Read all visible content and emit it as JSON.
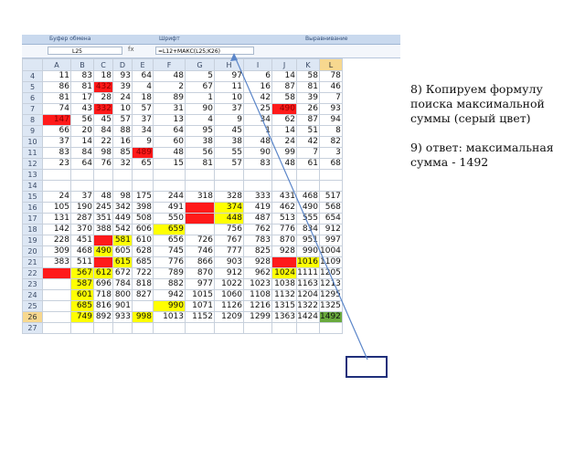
{
  "ribbon": {
    "groups": [
      "Буфер обмена",
      "Шрифт",
      "Выравнивание"
    ]
  },
  "formula_bar": {
    "name_box": "L25",
    "fx": "fx",
    "formula": "=L12+МАКС(L25;K26)"
  },
  "columns": [
    "A",
    "B",
    "C",
    "D",
    "E",
    "F",
    "G",
    "H",
    "I",
    "J",
    "K",
    "L"
  ],
  "rows": [
    {
      "n": "4",
      "c": [
        "11",
        "83",
        "18",
        "93",
        "64",
        "48",
        "5",
        "97",
        "6",
        "14",
        "58",
        "78"
      ]
    },
    {
      "n": "5",
      "c": [
        "86",
        "81",
        "432",
        "39",
        "4",
        "2",
        "67",
        "11",
        "16",
        "87",
        "81",
        "46"
      ]
    },
    {
      "n": "6",
      "c": [
        "81",
        "17",
        "28",
        "24",
        "18",
        "89",
        "1",
        "10",
        "42",
        "58",
        "39",
        "7"
      ]
    },
    {
      "n": "7",
      "c": [
        "74",
        "43",
        "332",
        "10",
        "57",
        "31",
        "90",
        "37",
        "25",
        "490",
        "26",
        "93"
      ]
    },
    {
      "n": "8",
      "c": [
        "147",
        "56",
        "45",
        "57",
        "37",
        "13",
        "4",
        "9",
        "34",
        "62",
        "87",
        "94"
      ]
    },
    {
      "n": "9",
      "c": [
        "66",
        "20",
        "84",
        "88",
        "34",
        "64",
        "95",
        "45",
        "1",
        "14",
        "51",
        "8"
      ]
    },
    {
      "n": "10",
      "c": [
        "37",
        "14",
        "22",
        "16",
        "9",
        "60",
        "38",
        "38",
        "48",
        "24",
        "42",
        "82"
      ]
    },
    {
      "n": "11",
      "c": [
        "83",
        "84",
        "98",
        "85",
        "489",
        "48",
        "56",
        "55",
        "90",
        "99",
        "7",
        "3"
      ]
    },
    {
      "n": "12",
      "c": [
        "23",
        "64",
        "76",
        "32",
        "65",
        "15",
        "81",
        "57",
        "83",
        "48",
        "61",
        "68"
      ]
    },
    {
      "n": "13",
      "c": [
        "",
        "",
        "",
        "",
        "",
        "",
        "",
        "",
        "",
        "",
        "",
        ""
      ]
    },
    {
      "n": "14",
      "c": [
        "",
        "",
        "",
        "",
        "",
        "",
        "",
        "",
        "",
        "",
        "",
        ""
      ]
    },
    {
      "n": "15",
      "c": [
        "24",
        "37",
        "48",
        "98",
        "175",
        "244",
        "318",
        "328",
        "333",
        "431",
        "468",
        "517"
      ]
    },
    {
      "n": "16",
      "c": [
        "105",
        "190",
        "245",
        "342",
        "398",
        "491",
        "",
        "374",
        "419",
        "462",
        "490",
        "568"
      ]
    },
    {
      "n": "17",
      "c": [
        "131",
        "287",
        "351",
        "449",
        "508",
        "550",
        "",
        "448",
        "487",
        "513",
        "555",
        "654"
      ]
    },
    {
      "n": "18",
      "c": [
        "142",
        "370",
        "388",
        "542",
        "606",
        "659",
        "",
        "756",
        "762",
        "776",
        "834",
        "912"
      ]
    },
    {
      "n": "19",
      "c": [
        "228",
        "451",
        "",
        "581",
        "610",
        "656",
        "726",
        "767",
        "783",
        "870",
        "951",
        "997"
      ]
    },
    {
      "n": "20",
      "c": [
        "309",
        "468",
        "490",
        "605",
        "628",
        "745",
        "746",
        "777",
        "825",
        "928",
        "990",
        "1004"
      ]
    },
    {
      "n": "21",
      "c": [
        "383",
        "511",
        "",
        "615",
        "685",
        "776",
        "866",
        "903",
        "928",
        "",
        "1016",
        "1109"
      ]
    },
    {
      "n": "22",
      "c": [
        "",
        "567",
        "612",
        "672",
        "722",
        "789",
        "870",
        "912",
        "962",
        "1024",
        "1111",
        "1205"
      ]
    },
    {
      "n": "23",
      "c": [
        "",
        "587",
        "696",
        "784",
        "818",
        "882",
        "977",
        "1022",
        "1023",
        "1038",
        "1163",
        "1213"
      ]
    },
    {
      "n": "24",
      "c": [
        "",
        "601",
        "718",
        "800",
        "827",
        "942",
        "1015",
        "1060",
        "1108",
        "1132",
        "1204",
        "1295"
      ]
    },
    {
      "n": "25",
      "c": [
        "",
        "685",
        "816",
        "901",
        "",
        "990",
        "1071",
        "1126",
        "1216",
        "1315",
        "1322",
        "1325"
      ]
    },
    {
      "n": "26",
      "c": [
        "",
        "749",
        "892",
        "933",
        "998",
        "1013",
        "1152",
        "1209",
        "1299",
        "1363",
        "1424",
        "1492"
      ]
    },
    {
      "n": "27",
      "c": [
        "",
        "",
        "",
        "",
        "",
        "",
        "",
        "",
        "",
        "",
        "",
        ""
      ]
    }
  ],
  "highlights": {
    "red": [
      "5-2",
      "7-2",
      "7-9",
      "8-0",
      "11-4",
      "16-6",
      "17-6",
      "19-2",
      "21-2",
      "21-9",
      "22-0"
    ],
    "yellow": [
      "16-7",
      "17-7",
      "18-5",
      "19-3",
      "20-2",
      "21-3",
      "21-10",
      "22-1",
      "22-2",
      "22-9",
      "23-1",
      "24-1",
      "25-1",
      "25-5",
      "26-1",
      "26-4"
    ],
    "green": [
      "26-11"
    ]
  },
  "caption": {
    "step": "8) Копируем формулу поиска максимальной суммы (серый цвет)",
    "answer": "9) ответ: максимальная сумма - 1492"
  },
  "colors": {
    "red": "#ff1a1a",
    "yellow": "#ffff00",
    "green": "#6aaa3e",
    "frame": "#1f2f7a",
    "arrow": "#5b86c9"
  }
}
